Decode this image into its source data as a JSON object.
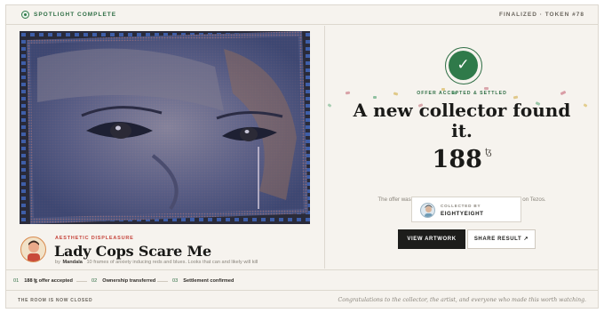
{
  "topbar": {
    "status": "SPOTLIGHT COMPLETE",
    "token": "FINALIZED · TOKEN #78"
  },
  "artwork": {
    "collection": "AESTHETIC DISPLEASURE",
    "title": "Lady Cops Scare Me",
    "by": "by",
    "artist": "Mandala",
    "description": "10 frames of anxiety inducing reds and blues. Looks that can and likely will kill"
  },
  "result": {
    "accepted_label": "OFFER ACCEPTED & SETTLED",
    "headline": "A new collector found it.",
    "amount": "188",
    "currency_symbol": "ꜩ",
    "note": "The offer was accepted. Ownership and funds have settled on Tezos.",
    "collector_label": "COLLECTED BY",
    "collector_name": "EIGHTYEIGHT"
  },
  "actions": {
    "view_artwork": "VIEW ARTWORK",
    "share_result": "SHARE RESULT ↗"
  },
  "steps": [
    {
      "num": "01",
      "label": "188 ꜩ offer accepted"
    },
    {
      "num": "02",
      "label": "Ownership transferred"
    },
    {
      "num": "03",
      "label": "Settlement confirmed"
    }
  ],
  "footer": {
    "left": "THE ROOM IS NOW CLOSED",
    "right": "Congratulations to the collector, the artist, and everyone who made this worth watching."
  },
  "colors": {
    "accent_green": "#2f7a4a",
    "collection_red": "#c6453c",
    "background": "#f6f3ee"
  },
  "icons": [
    "status-dot-icon",
    "check-icon",
    "share-arrow-icon"
  ]
}
